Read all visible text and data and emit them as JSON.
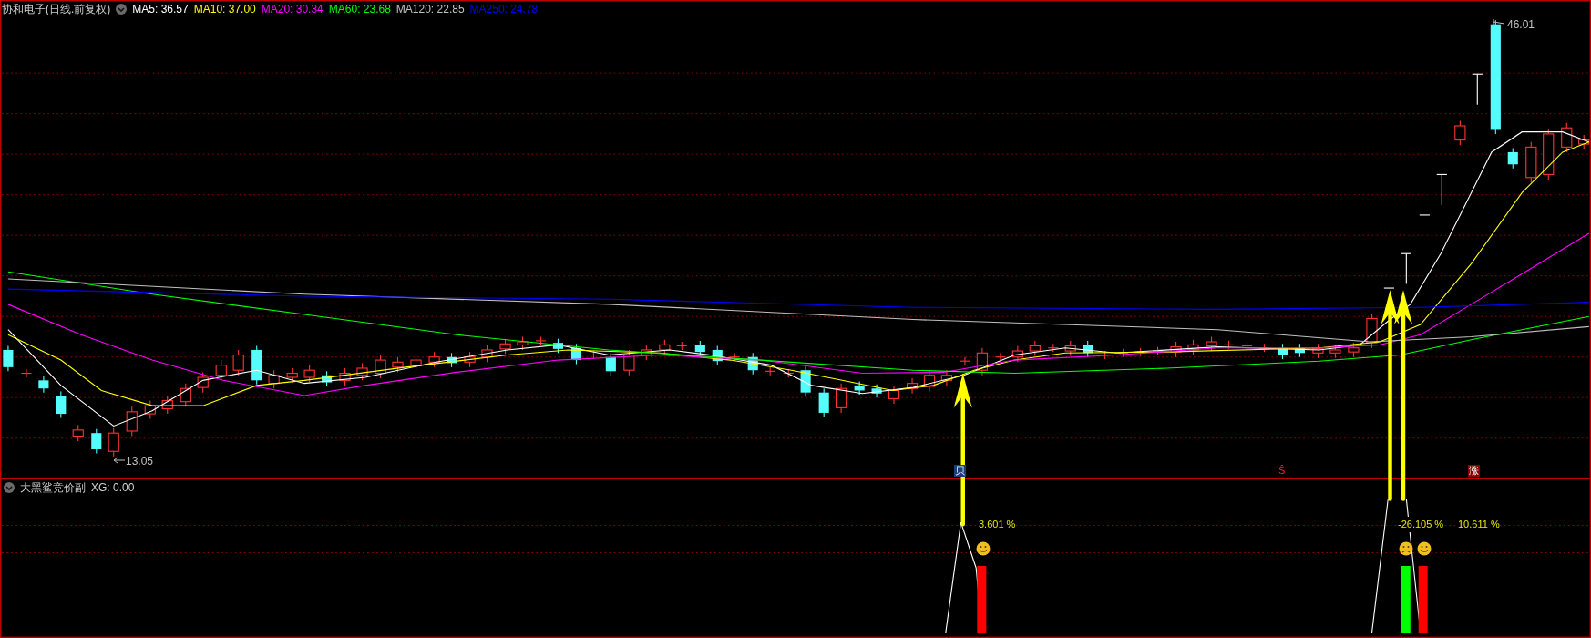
{
  "chart": {
    "title": "协和电子(日线.前复权)",
    "indicators": [
      {
        "label": "MA5: 36.57",
        "color": "#ffffff"
      },
      {
        "label": "MA10: 37.00",
        "color": "#ffff00"
      },
      {
        "label": "MA20: 30.34",
        "color": "#ff00ff"
      },
      {
        "label": "MA60: 23.68",
        "color": "#00ff00"
      },
      {
        "label": "MA120: 22.85",
        "color": "#c0c0c0"
      },
      {
        "label": "MA250: 24.78",
        "color": "#0000ff"
      }
    ],
    "high_label": "46.01",
    "low_label": "13.05",
    "signals": [
      {
        "text": "贝",
        "kind": "buy"
      },
      {
        "text": "Ŝ",
        "kind": "dollar"
      },
      {
        "text": "涨",
        "kind": "rise"
      }
    ]
  },
  "sub_panel": {
    "title": "大黑鲨竞价副",
    "value": "XG: 0.00",
    "markers": [
      {
        "text": "3.601 %",
        "kind": "smile"
      },
      {
        "text": "-26.105 %",
        "kind": "frown"
      },
      {
        "text": "10.611 %",
        "kind": "smile"
      }
    ],
    "bars": [
      {
        "color": "#ff0000"
      },
      {
        "color": "#00ff00"
      },
      {
        "color": "#ff0000"
      }
    ]
  }
}
